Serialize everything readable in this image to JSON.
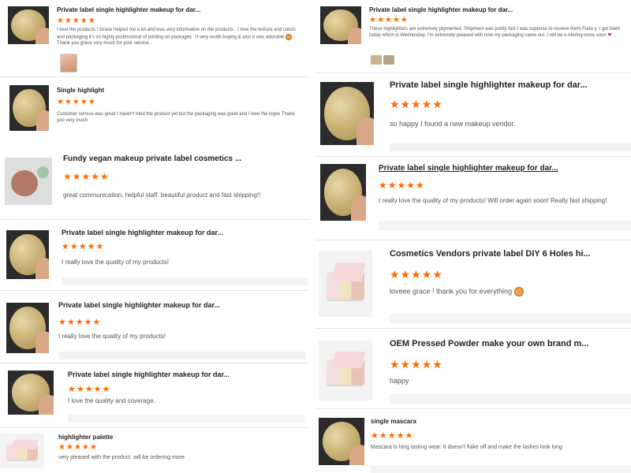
{
  "reviews": [
    {
      "title": "Private label single highlighter makeup for dar...",
      "stars": "★★★★★",
      "text": "I love the products ! Grace helped me a lot and was very informative on the products . I love the texture and colors and packaging it's so highly professional of printing on packages . It very worth buying & also it was adorable",
      "text_after": "Thank you grace very much for your service ."
    },
    {
      "title": "Single highlight",
      "stars": "★★★★★",
      "text": "Customer service was great I haven't tried the product yet but the packaging was good and I love the logos Thank you very much"
    },
    {
      "title": "Fundy vegan makeup private label cosmetics ...",
      "stars": "★★★★★",
      "text": "great communication, helpful staff. beautiful product and fast shipping!!"
    },
    {
      "title": "Private label single highlighter makeup for dar...",
      "stars": "★★★★★",
      "text": "I really love the quality of my products!"
    },
    {
      "title": "Private label single highlighter makeup for dar...",
      "stars": "★★★★★",
      "text": "I really love the quality of my products!"
    },
    {
      "title": "Private label single highlighter makeup for dar...",
      "stars": "★★★★★",
      "text": "I love the quality and coverage."
    },
    {
      "title": "highlighter palette",
      "stars": "★★★★★",
      "text": "very pleased with the product. will be ordering more"
    },
    {
      "title": "Private label single highlighter makeup for dar...",
      "stars": "★★★★★",
      "text": "These highlighters are extremely pigmented. Shipment was pretty fast I was suppose to receive them Frida y. I got them today which is Wednesday. I'm extremely pleased with how my packaging came out. I will be o rdering more soon"
    },
    {
      "title": "Private label single highlighter makeup for dar...",
      "stars": "★★★★★",
      "text": "so happy I found a new makeup vendor."
    },
    {
      "title": "Private label single highlighter makeup for dar...",
      "stars": "★★★★★",
      "text": "I really love the quality of my products! Will order again soon! Really fast shipping!"
    },
    {
      "title": "Cosmetics Vendors private label DIY 6 Holes hi...",
      "stars": "★★★★★",
      "text": "loveee grace ! thank you for everything"
    },
    {
      "title": "OEM Pressed Powder make your own brand m...",
      "stars": "★★★★★",
      "text": "happy"
    },
    {
      "title": "single mascara",
      "stars": "★★★★★",
      "text": "Mascara is long lasting wear. It doesn't flake off and make the lashes look long"
    }
  ],
  "colors": {
    "star": "#ff6a00",
    "title": "#222222",
    "body_text": "#555555"
  },
  "icons": {
    "emoji": "smiling-face-emoji-icon",
    "heart": "heart-icon"
  }
}
